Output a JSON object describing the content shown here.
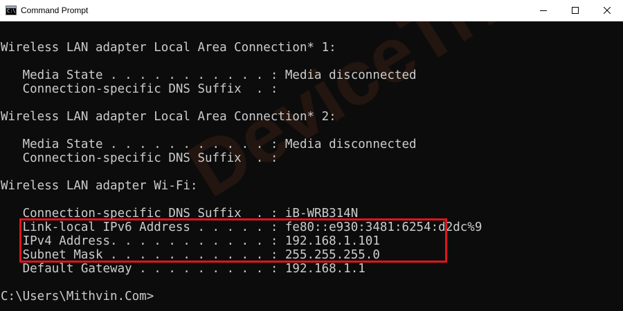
{
  "window": {
    "title": "Command Prompt",
    "icon": "cmd-icon",
    "controls": {
      "minimize_icon": "minimize-icon",
      "maximize_icon": "maximize-icon",
      "close_icon": "close-icon"
    }
  },
  "watermark": {
    "text": "DeviceTricks"
  },
  "console": {
    "lines": [
      "",
      "Wireless LAN adapter Local Area Connection* 1:",
      "",
      "   Media State . . . . . . . . . . . : Media disconnected",
      "   Connection-specific DNS Suffix  . :",
      "",
      "Wireless LAN adapter Local Area Connection* 2:",
      "",
      "   Media State . . . . . . . . . . . : Media disconnected",
      "   Connection-specific DNS Suffix  . :",
      "",
      "Wireless LAN adapter Wi-Fi:",
      "",
      "   Connection-specific DNS Suffix  . : iB-WRB314N",
      "   Link-local IPv6 Address . . . . . : fe80::e930:3481:6254:d2dc%9",
      "   IPv4 Address. . . . . . . . . . . : 192.168.1.101",
      "   Subnet Mask . . . . . . . . . . . : 255.255.255.0",
      "   Default Gateway . . . . . . . . . : 192.168.1.1",
      "",
      "C:\\Users\\Mithvin.Com>"
    ]
  },
  "colors": {
    "console_background": "#0c0c0c",
    "console_text": "#cccccc",
    "highlight": "#e0141c"
  }
}
